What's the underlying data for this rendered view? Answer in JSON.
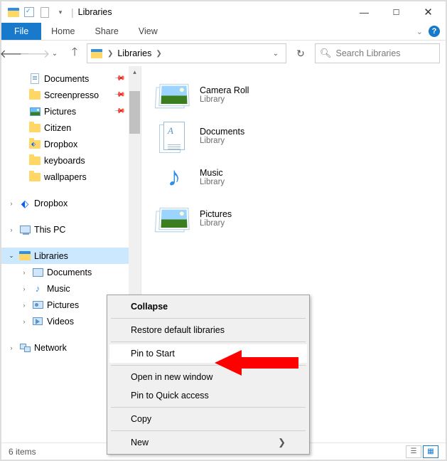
{
  "titlebar": {
    "title": "Libraries"
  },
  "ribbon": {
    "file": "File",
    "tabs": [
      "Home",
      "Share",
      "View"
    ]
  },
  "address": {
    "text": "Libraries",
    "search_placeholder": "Search Libraries"
  },
  "sidebar": {
    "quick": [
      {
        "label": "Documents",
        "icon": "doc",
        "pinned": true
      },
      {
        "label": "Screenpresso",
        "icon": "folder",
        "pinned": true
      },
      {
        "label": "Pictures",
        "icon": "pic",
        "pinned": true
      },
      {
        "label": "Citizen",
        "icon": "folder",
        "pinned": false
      },
      {
        "label": "Dropbox",
        "icon": "dbx-folder",
        "pinned": false
      },
      {
        "label": "keyboards",
        "icon": "folder",
        "pinned": false
      },
      {
        "label": "wallpapers",
        "icon": "folder",
        "pinned": false
      }
    ],
    "roots": [
      {
        "label": "Dropbox",
        "icon": "dbx"
      },
      {
        "label": "This PC",
        "icon": "pc"
      }
    ],
    "libraries": {
      "label": "Libraries",
      "children": [
        {
          "label": "Documents",
          "icon": "doc-lib"
        },
        {
          "label": "Music",
          "icon": "music-lib"
        },
        {
          "label": "Pictures",
          "icon": "pic-lib"
        },
        {
          "label": "Videos",
          "icon": "vid-lib"
        }
      ]
    },
    "network": {
      "label": "Network"
    }
  },
  "content": {
    "items": [
      {
        "name": "Camera Roll",
        "type": "Library",
        "icon": "pic"
      },
      {
        "name": "Documents",
        "type": "Library",
        "icon": "doc"
      },
      {
        "name": "Music",
        "type": "Library",
        "icon": "music"
      },
      {
        "name": "Pictures",
        "type": "Library",
        "icon": "pic"
      }
    ]
  },
  "ctx": {
    "collapse": "Collapse",
    "restore": "Restore default libraries",
    "pin_start": "Pin to Start",
    "open_new": "Open in new window",
    "pin_quick": "Pin to Quick access",
    "copy": "Copy",
    "new": "New"
  },
  "status": {
    "count": "6 items"
  }
}
